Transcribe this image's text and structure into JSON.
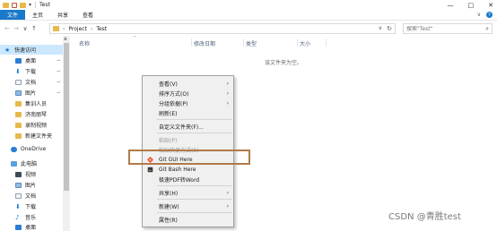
{
  "window": {
    "title": "Test",
    "qa_arrow": "▾",
    "minimize": "—",
    "maximize": "□",
    "close": "✕"
  },
  "ribbon": {
    "tabs": [
      {
        "label": "文件"
      },
      {
        "label": "主页"
      },
      {
        "label": "共享"
      },
      {
        "label": "查看"
      }
    ],
    "collapse": "∨",
    "help": "?"
  },
  "addressbar": {
    "back": "←",
    "forward": "→",
    "recent": "∨",
    "up": "↑",
    "crumbs": [
      "Project",
      "Test"
    ],
    "crumb_sep": "›",
    "dropdown": "∨",
    "refresh": "↻"
  },
  "search": {
    "placeholder": "搜索\"Test\"",
    "icon": "⌕"
  },
  "nav": {
    "items": [
      {
        "label": "快速访问",
        "icon": "star-icon",
        "selected": true
      },
      {
        "label": "桌面",
        "icon": "desktop-icon",
        "pinned": true
      },
      {
        "label": "下载",
        "icon": "download-icon",
        "pinned": true
      },
      {
        "label": "文档",
        "icon": "document-icon",
        "pinned": true
      },
      {
        "label": "图片",
        "icon": "picture-icon",
        "pinned": true
      },
      {
        "label": "集训人员",
        "icon": "folder-icon"
      },
      {
        "label": "济南丽琴",
        "icon": "folder-icon"
      },
      {
        "label": "录制视频",
        "icon": "folder-icon"
      },
      {
        "label": "新建文件夹",
        "icon": "folder-icon"
      },
      {
        "label": "OneDrive",
        "icon": "onedrive-icon"
      },
      {
        "label": "此电脑",
        "icon": "pc-icon"
      },
      {
        "label": "视频",
        "icon": "video-icon"
      },
      {
        "label": "图片",
        "icon": "picture-icon"
      },
      {
        "label": "文档",
        "icon": "document-icon"
      },
      {
        "label": "下载",
        "icon": "download-icon"
      },
      {
        "label": "音乐",
        "icon": "music-icon"
      },
      {
        "label": "桌面",
        "icon": "desktop-icon"
      }
    ],
    "pin_glyph": "⊸",
    "scroll_up": "▲"
  },
  "content": {
    "columns": [
      "名称",
      "修改日期",
      "类型",
      "大小"
    ],
    "sort_arrow": "^",
    "empty_message": "该文件夹为空。"
  },
  "context_menu": {
    "items": [
      {
        "label": "查看(V)",
        "submenu": true
      },
      {
        "label": "排序方式(O)",
        "submenu": true
      },
      {
        "label": "分组依据(P)",
        "submenu": true
      },
      {
        "label": "刷新(E)"
      },
      {
        "sep": true
      },
      {
        "label": "自定义文件夹(F)..."
      },
      {
        "sep": true
      },
      {
        "label": "粘贴(P)",
        "disabled": true
      },
      {
        "label": "粘贴快捷方式(S)",
        "disabled": true
      },
      {
        "label": "Git GUI Here",
        "icon": "git-gui-icon"
      },
      {
        "label": "Git Bash Here",
        "icon": "git-bash-icon"
      },
      {
        "label": "极速PDF转Word"
      },
      {
        "sep": true
      },
      {
        "label": "共享(H)",
        "submenu": true
      },
      {
        "sep": true
      },
      {
        "label": "新建(W)",
        "submenu": true
      },
      {
        "sep": true
      },
      {
        "label": "属性(R)"
      }
    ],
    "submenu_arrow": "›"
  },
  "watermark": "CSDN @青胜test",
  "colors": {
    "accent": "#1979ca",
    "highlight_box": "#b07a48",
    "folder": "#e8b84a",
    "selected_bg": "#cce8ff"
  }
}
